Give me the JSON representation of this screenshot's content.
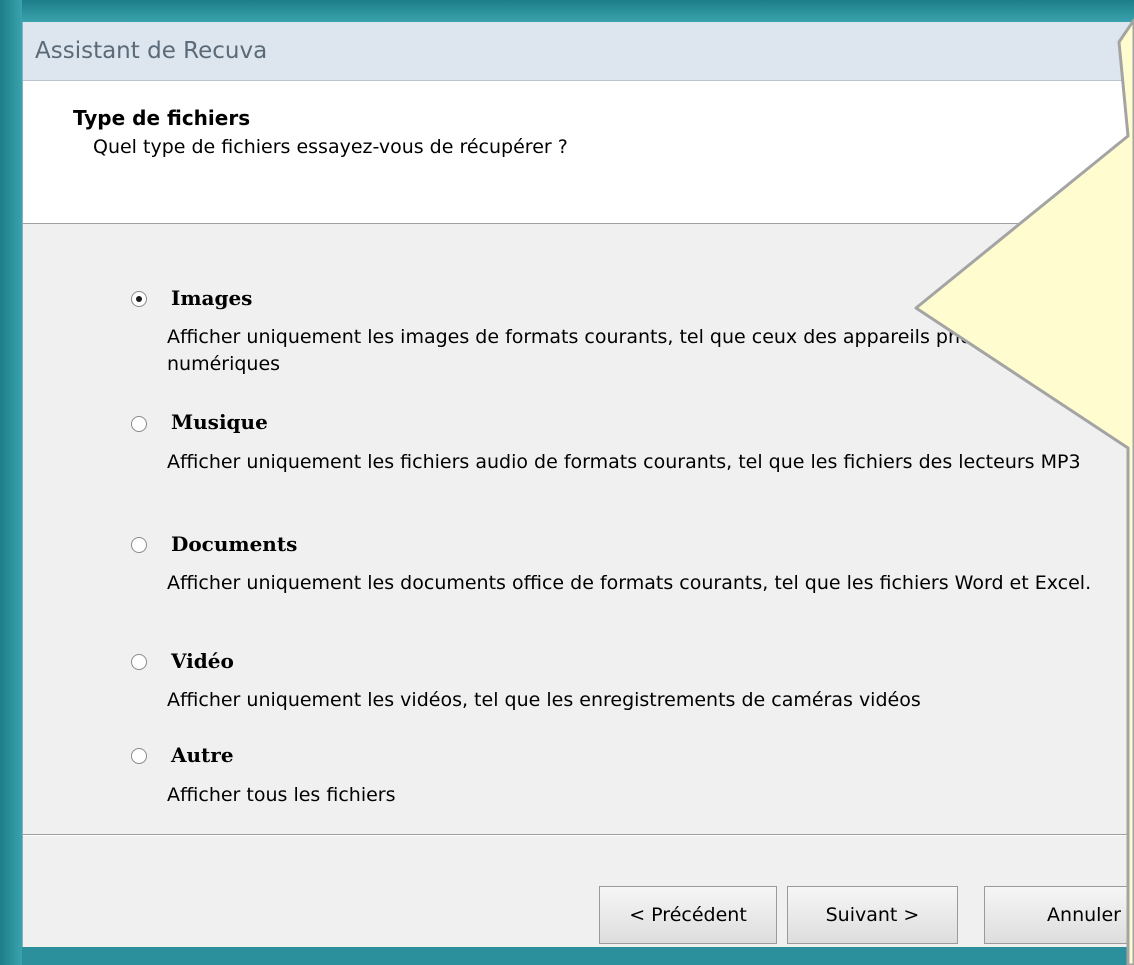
{
  "window": {
    "title": "Assistant de Recuva"
  },
  "header": {
    "title": "Type de fichiers",
    "subtitle": "Quel type de fichiers essayez-vous de récupérer ?",
    "icon": "wizard-icon"
  },
  "options": [
    {
      "label": "Images",
      "description": "Afficher uniquement les images de formats courants, tel que ceux des appareils photo numériques",
      "checked": true
    },
    {
      "label": "Musique",
      "description": "Afficher uniquement les fichiers audio de formats courants, tel que les fichiers des lecteurs MP3",
      "checked": false
    },
    {
      "label": "Documents",
      "description": "Afficher uniquement les documents office de formats courants, tel que les fichiers Word et Excel.",
      "checked": false
    },
    {
      "label": "Vidéo",
      "description": "Afficher uniquement les vidéos, tel que les enregistrements de caméras vidéos",
      "checked": false
    },
    {
      "label": "Autre",
      "description": "Afficher tous les fichiers",
      "checked": false
    }
  ],
  "buttons": {
    "previous": "< Précédent",
    "next": "Suivant >",
    "cancel": "Annuler"
  },
  "colors": {
    "desktop": "#2b8f9c",
    "tooltip": "#fffdd0"
  }
}
